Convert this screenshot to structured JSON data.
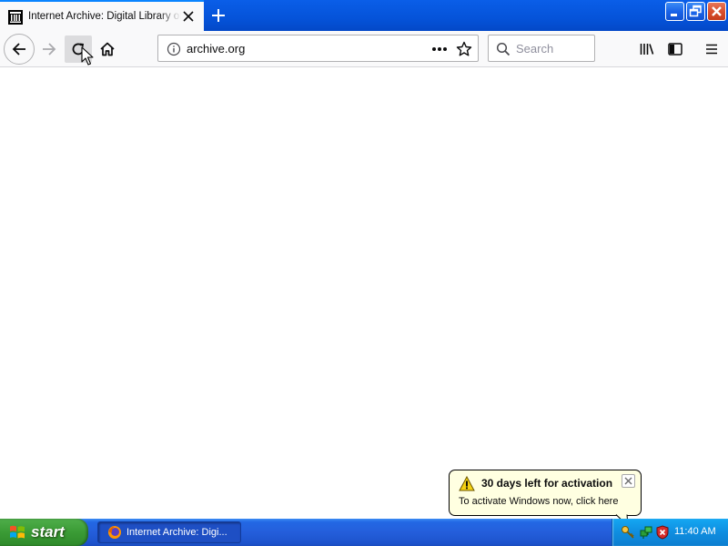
{
  "browser": {
    "tab": {
      "title": "Internet Archive: Digital Library of Free & Borrowable Books, Movies, Music & Wayback Machine",
      "favicon": "archive-building-icon",
      "close_icon": "close-icon"
    },
    "new_tab_icon": "plus-icon",
    "window_controls": [
      "minimize-icon",
      "restore-icon",
      "close-icon"
    ],
    "nav": {
      "back_icon": "arrow-left-icon",
      "forward_icon": "arrow-right-icon",
      "reload_icon": "reload-icon",
      "home_icon": "home-icon"
    },
    "urlbar": {
      "info_icon": "info-icon",
      "url": "archive.org",
      "page_actions_icon": "ellipsis-icon",
      "bookmark_icon": "star-icon"
    },
    "search": {
      "placeholder": "Search",
      "icon": "search-icon"
    },
    "toolbar_right": [
      "library-icon",
      "sidebar-icon",
      "hamburger-menu-icon"
    ]
  },
  "balloon": {
    "title": "30 days left for activation",
    "body": "To activate Windows now, click here",
    "icon": "warning-icon"
  },
  "taskbar": {
    "start_label": "start",
    "item_label": "Internet Archive: Digi...",
    "clock": "11:40 AM",
    "tray_icons": [
      "activation-key-icon",
      "network-icon",
      "security-shield-icon"
    ]
  },
  "colors": {
    "titlebar_blue": "#0553d9",
    "tab_accent": "#0a84ff",
    "start_green": "#3a9b35",
    "taskbar_blue": "#245edb",
    "tray_blue": "#0f8ee0",
    "balloon_yellow": "#ffffe1"
  }
}
